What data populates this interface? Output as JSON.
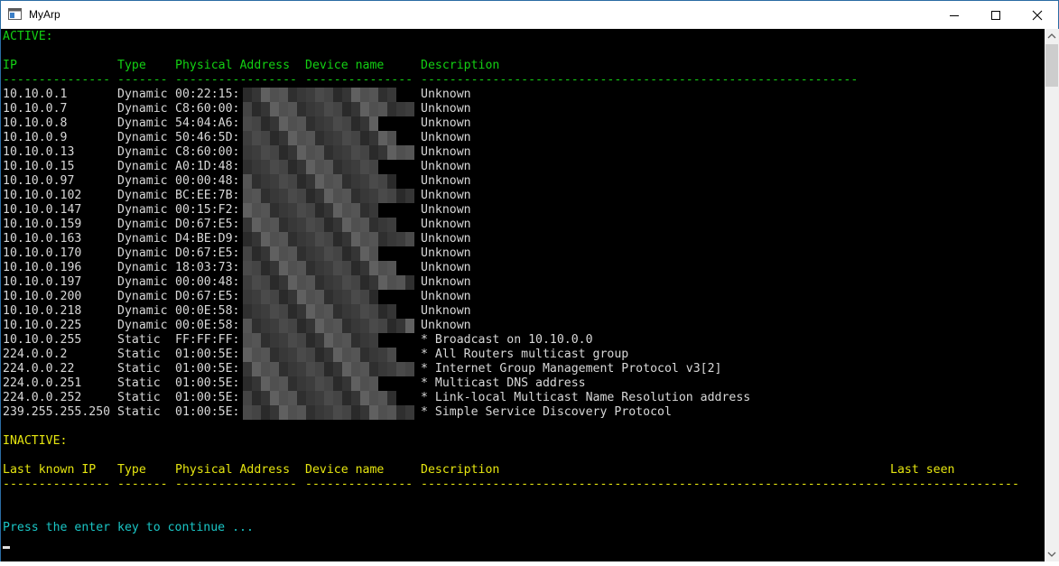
{
  "window": {
    "title": "MyArp",
    "icon": "console-window-icon",
    "controls": [
      "minimize-icon",
      "maximize-icon",
      "close-icon"
    ]
  },
  "active": {
    "heading": "ACTIVE:",
    "headers": {
      "ip": "IP",
      "type": "Type",
      "mac": "Physical Address",
      "device": "Device name",
      "desc": "Description"
    },
    "separator": "--------------- ------- ----------------- --------------- -------------------------------------------------------------",
    "rows": [
      {
        "ip": "10.10.0.1",
        "type": "Dynamic",
        "mac": "00:22:15:",
        "desc": "Unknown"
      },
      {
        "ip": "10.10.0.7",
        "type": "Dynamic",
        "mac": "C8:60:00:",
        "desc": "Unknown"
      },
      {
        "ip": "10.10.0.8",
        "type": "Dynamic",
        "mac": "54:04:A6:",
        "desc": "Unknown"
      },
      {
        "ip": "10.10.0.9",
        "type": "Dynamic",
        "mac": "50:46:5D:",
        "desc": "Unknown"
      },
      {
        "ip": "10.10.0.13",
        "type": "Dynamic",
        "mac": "C8:60:00:",
        "desc": "Unknown"
      },
      {
        "ip": "10.10.0.15",
        "type": "Dynamic",
        "mac": "A0:1D:48:",
        "desc": "Unknown"
      },
      {
        "ip": "10.10.0.97",
        "type": "Dynamic",
        "mac": "00:00:48:",
        "desc": "Unknown"
      },
      {
        "ip": "10.10.0.102",
        "type": "Dynamic",
        "mac": "BC:EE:7B:",
        "desc": "Unknown"
      },
      {
        "ip": "10.10.0.147",
        "type": "Dynamic",
        "mac": "00:15:F2:",
        "desc": "Unknown"
      },
      {
        "ip": "10.10.0.159",
        "type": "Dynamic",
        "mac": "D0:67:E5:",
        "desc": "Unknown"
      },
      {
        "ip": "10.10.0.163",
        "type": "Dynamic",
        "mac": "D4:BE:D9:",
        "desc": "Unknown"
      },
      {
        "ip": "10.10.0.170",
        "type": "Dynamic",
        "mac": "D0:67:E5:",
        "desc": "Unknown"
      },
      {
        "ip": "10.10.0.196",
        "type": "Dynamic",
        "mac": "18:03:73:",
        "desc": "Unknown"
      },
      {
        "ip": "10.10.0.197",
        "type": "Dynamic",
        "mac": "00:00:48:",
        "desc": "Unknown"
      },
      {
        "ip": "10.10.0.200",
        "type": "Dynamic",
        "mac": "D0:67:E5:",
        "desc": "Unknown"
      },
      {
        "ip": "10.10.0.218",
        "type": "Dynamic",
        "mac": "00:0E:58:",
        "desc": "Unknown"
      },
      {
        "ip": "10.10.0.225",
        "type": "Dynamic",
        "mac": "00:0E:58:",
        "desc": "Unknown"
      },
      {
        "ip": "10.10.0.255",
        "type": "Static",
        "mac": "FF:FF:FF:",
        "desc": "* Broadcast on 10.10.0.0"
      },
      {
        "ip": "224.0.0.2",
        "type": "Static",
        "mac": "01:00:5E:",
        "desc": "* All Routers multicast group"
      },
      {
        "ip": "224.0.0.22",
        "type": "Static",
        "mac": "01:00:5E:",
        "desc": "* Internet Group Management Protocol v3[2]"
      },
      {
        "ip": "224.0.0.251",
        "type": "Static",
        "mac": "01:00:5E:",
        "desc": "* Multicast DNS address"
      },
      {
        "ip": "224.0.0.252",
        "type": "Static",
        "mac": "01:00:5E:",
        "desc": "* Link-local Multicast Name Resolution address"
      },
      {
        "ip": "239.255.255.250",
        "type": "Static",
        "mac": "01:00:5E:",
        "desc": "* Simple Service Discovery Protocol"
      }
    ]
  },
  "inactive": {
    "heading": "INACTIVE:",
    "headers": {
      "ip": "Last known IP",
      "type": "Type",
      "mac": "Physical Address",
      "device": "Device name",
      "desc": "Description",
      "seen": "Last seen"
    },
    "separator": "--------------- ------- ----------------- --------------- ----------------------------------------------------------------- -------------------"
  },
  "prompt": "Press the enter key to continue ...",
  "colors": {
    "active": "#13d013",
    "inactive": "#e5e510",
    "prompt": "#1ac5c5",
    "text": "#d8d8d8",
    "background": "#000000"
  }
}
